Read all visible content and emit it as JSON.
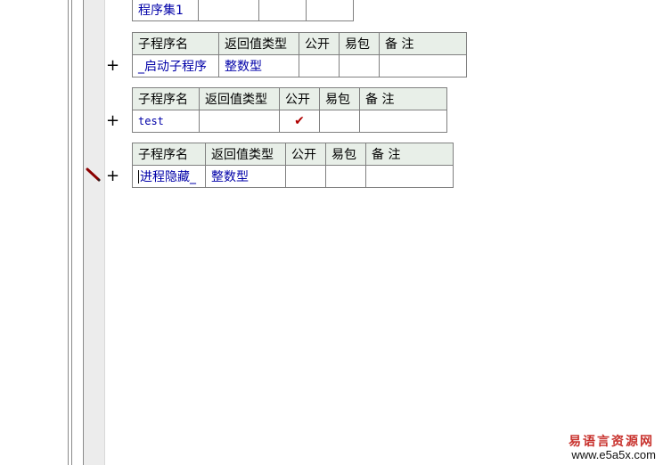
{
  "assembly_table": {
    "name": "程序集1"
  },
  "sub_tables": [
    {
      "headers": [
        "子程序名",
        "返回值类型",
        "公开",
        "易包",
        "备 注"
      ],
      "row": {
        "name": "_启动子程序",
        "return_type": "整数型",
        "public": "",
        "easy_pkg": "",
        "note": ""
      }
    },
    {
      "headers": [
        "子程序名",
        "返回值类型",
        "公开",
        "易包",
        "备 注"
      ],
      "row": {
        "name": "test",
        "return_type": "",
        "public": "✔",
        "easy_pkg": "",
        "note": ""
      }
    },
    {
      "headers": [
        "子程序名",
        "返回值类型",
        "公开",
        "易包",
        "备 注"
      ],
      "row": {
        "name": "进程隐藏_",
        "return_type": "整数型",
        "public": "",
        "easy_pkg": "",
        "note": ""
      }
    }
  ],
  "expand_symbol": "+",
  "watermark": {
    "line1": "易语言资源网",
    "line2": "www.e5a5x.com"
  }
}
